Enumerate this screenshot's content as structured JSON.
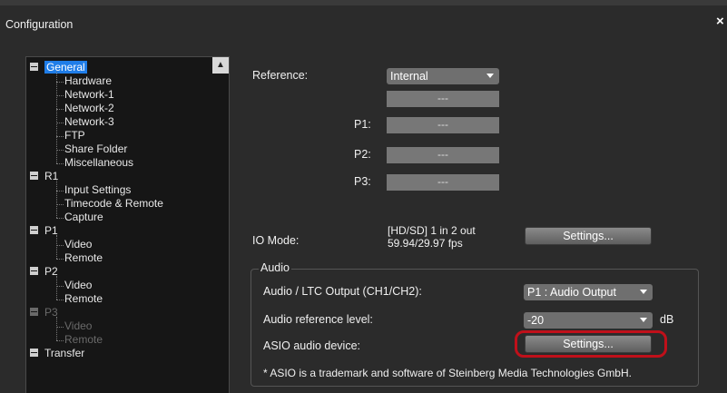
{
  "window": {
    "title": "Configuration",
    "close_glyph": "×"
  },
  "tree": {
    "items": [
      {
        "type": "group",
        "label": "General",
        "selected": true
      },
      {
        "type": "child",
        "label": "Hardware"
      },
      {
        "type": "child",
        "label": "Network-1"
      },
      {
        "type": "child",
        "label": "Network-2"
      },
      {
        "type": "child",
        "label": "Network-3"
      },
      {
        "type": "child",
        "label": "FTP"
      },
      {
        "type": "child",
        "label": "Share Folder"
      },
      {
        "type": "child",
        "label": "Miscellaneous"
      },
      {
        "type": "group",
        "label": "R1"
      },
      {
        "type": "child",
        "label": "Input Settings"
      },
      {
        "type": "child",
        "label": "Timecode & Remote"
      },
      {
        "type": "child",
        "label": "Capture"
      },
      {
        "type": "group",
        "label": "P1"
      },
      {
        "type": "child",
        "label": "Video"
      },
      {
        "type": "child",
        "label": "Remote"
      },
      {
        "type": "group",
        "label": "P2"
      },
      {
        "type": "child",
        "label": "Video"
      },
      {
        "type": "child",
        "label": "Remote"
      },
      {
        "type": "group",
        "label": "P3",
        "disabled": true
      },
      {
        "type": "child",
        "label": "Video",
        "disabled": true
      },
      {
        "type": "child",
        "label": "Remote",
        "disabled": true
      },
      {
        "type": "group",
        "label": "Transfer"
      }
    ]
  },
  "reference": {
    "label": "Reference:",
    "value": "Internal",
    "main_field": "---",
    "p1_label": "P1:",
    "p1_value": "---",
    "p2_label": "P2:",
    "p2_value": "---",
    "p3_label": "P3:",
    "p3_value": "---"
  },
  "io_mode": {
    "label": "IO Mode:",
    "line1": "[HD/SD] 1 in 2 out",
    "line2": "59.94/29.97 fps",
    "button": "Settings..."
  },
  "audio": {
    "group_title": "Audio",
    "ltc_label": "Audio / LTC Output (CH1/CH2):",
    "ltc_value": "P1 : Audio Output",
    "ref_level_label": "Audio reference level:",
    "ref_level_value": "-20",
    "ref_level_unit": "dB",
    "asio_label": "ASIO audio device:",
    "asio_button": "Settings...",
    "footnote": "* ASIO is a trademark and software of Steinberg Media Technologies GmbH."
  },
  "colors": {
    "selection": "#1f7de8",
    "highlight": "#c0101a",
    "background": "#2b2b2b"
  }
}
